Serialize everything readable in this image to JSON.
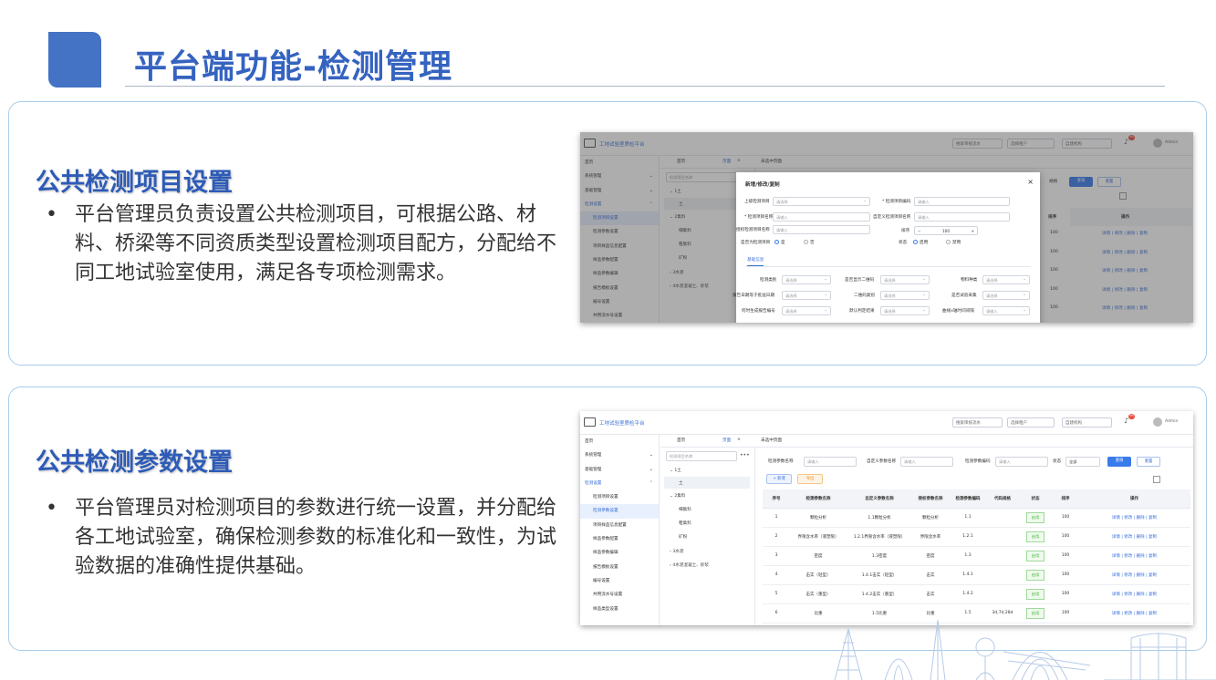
{
  "header": {
    "title": "平台端功能-检测管理"
  },
  "section1": {
    "title": "公共检测项目设置",
    "bullet": "平台管理员负责设置公共检测项目，可根据公路、材料、桥梁等不同资质类型设置检测项目配方，分配给不同工地试验室使用，满足各专项检测需求。"
  },
  "section2": {
    "title": "公共检测参数设置",
    "bullet": "平台管理员对检测项目的参数进行统一设置，并分配给各工地试验室，确保检测参数的标准化和一致性，为试验数据的准确性提供基础。"
  },
  "bullet_char": "•",
  "app": {
    "title": "工地试验室质检平台",
    "search_placeholder": "搜索审核流水",
    "project_placeholder": "选择租户",
    "org_select": "自建机构",
    "badge": "99",
    "user": "Admin",
    "sidebar": [
      {
        "label": "首页",
        "type": "top"
      },
      {
        "label": "系统管理",
        "type": "group"
      },
      {
        "label": "基础管理",
        "type": "group"
      },
      {
        "label": "检测设置",
        "type": "group-open"
      },
      {
        "label": "检测项目设置",
        "type": "sub"
      },
      {
        "label": "检测参数设置",
        "type": "sub"
      },
      {
        "label": "项目样品信息配置",
        "type": "sub"
      },
      {
        "label": "样品参数配置",
        "type": "sub"
      },
      {
        "label": "样品参数编辑",
        "type": "sub"
      },
      {
        "label": "报告模板设置",
        "type": "sub"
      },
      {
        "label": "编号设置",
        "type": "sub"
      },
      {
        "label": "共用流水号设置",
        "type": "sub"
      },
      {
        "label": "样品类型设置",
        "type": "sub"
      }
    ],
    "tabs": [
      "首页",
      "页面",
      "×",
      "未选中页面"
    ],
    "tree_search": "检测项目名称",
    "tree": [
      "1土",
      "土",
      "2集料",
      "细集料",
      "粗集料",
      "矿粉",
      "3水泥",
      "4水泥混凝土、砂浆"
    ]
  },
  "shot1": {
    "filter_label": "规格",
    "search_btn": "查询",
    "reset_btn": "重置",
    "sort_header": "排序",
    "op_header": "操作",
    "sort_vals": [
      "100",
      "100",
      "100",
      "100",
      "100",
      "100"
    ],
    "ops": "详情 | 修改 | 删除 | 复制",
    "modal": {
      "title": "新增/修改/复制",
      "close": "×",
      "fields": {
        "parent_label": "上级检测项目",
        "parent_ph": "请选择",
        "code_label": "* 检测项目编码",
        "code_ph": "请输入",
        "name_label": "* 检测项目名称",
        "name_ph": "请输入",
        "custom_label": "自定义检测项目名称",
        "custom_ph": "请输入",
        "auth_label": "授权检测项目名称",
        "auth_ph": "请输入",
        "order_label": "排序",
        "order_minus": "−",
        "order_val": "100",
        "order_plus": "+",
        "show_label": "是否为检测项目",
        "yes": "是",
        "no": "否",
        "status_label": "状态",
        "enabled": "启用",
        "disabled": "禁用"
      },
      "tab": "基础信息",
      "rows": [
        [
          "检测类别",
          "请选择",
          "是否显示二维码",
          "请选择",
          "物料种类",
          "请选择"
        ],
        [
          "报告日期等于批准日期",
          "请选择",
          "二维码类别",
          "请选择",
          "是否试验采集",
          "请选择"
        ],
        [
          "何时生成报告编号",
          "请选择",
          "默认判定结果",
          "请选择",
          "曲线x轴时间间隔",
          "请输入"
        ]
      ]
    }
  },
  "shot2": {
    "filters": {
      "name_label": "检测参数名称",
      "name_ph": "请输入",
      "custom_label": "自定义参数名称",
      "custom_ph": "请输入",
      "code_label": "检测参数编码",
      "code_ph": "请输入",
      "status_label": "状态",
      "status_val": "全部"
    },
    "search_btn": "查询",
    "reset_btn": "重置",
    "add_btn": "+ 新增",
    "export_btn": "导出",
    "columns": [
      "序号",
      "检测参数名称",
      "自定义参数名称",
      "授权参数名称",
      "检测参数编码",
      "代码规格",
      "状态",
      "排序",
      "操作"
    ],
    "rows": [
      [
        "1",
        "颗粒分析",
        "1.1颗粒分析",
        "颗粒分析",
        "1.1",
        "",
        "启用",
        "100",
        "详情 | 修改 | 删除 | 复制"
      ],
      [
        "2",
        "界限含水率（液塑限）",
        "1.2.1界限含水率（液塑限）",
        "界限含水率",
        "1.2.1",
        "",
        "启用",
        "100",
        "详情 | 修改 | 删除 | 复制"
      ],
      [
        "3",
        "密度",
        "1.3密度",
        "密度",
        "1.3",
        "",
        "启用",
        "100",
        "详情 | 修改 | 删除 | 复制"
      ],
      [
        "4",
        "击实（轻型）",
        "1.4.1击实（轻型）",
        "击实",
        "1.4.1",
        "",
        "启用",
        "100",
        "详情 | 修改 | 删除 | 复制"
      ],
      [
        "5",
        "击实（重型）",
        "1.4.2击实（重型）",
        "击实",
        "1.4.2",
        "",
        "启用",
        "100",
        "详情 | 修改 | 删除 | 复制"
      ],
      [
        "6",
        "比重",
        "1.5比重",
        "比重",
        "1.5",
        "3d,7d,28d",
        "启用",
        "100",
        "详情 | 修改 | 删除 | 复制"
      ]
    ]
  },
  "colors": {
    "accent": "#4472c4",
    "title": "#3563c0",
    "link": "#3a6fd8",
    "panel_border": "#a8cdea"
  }
}
